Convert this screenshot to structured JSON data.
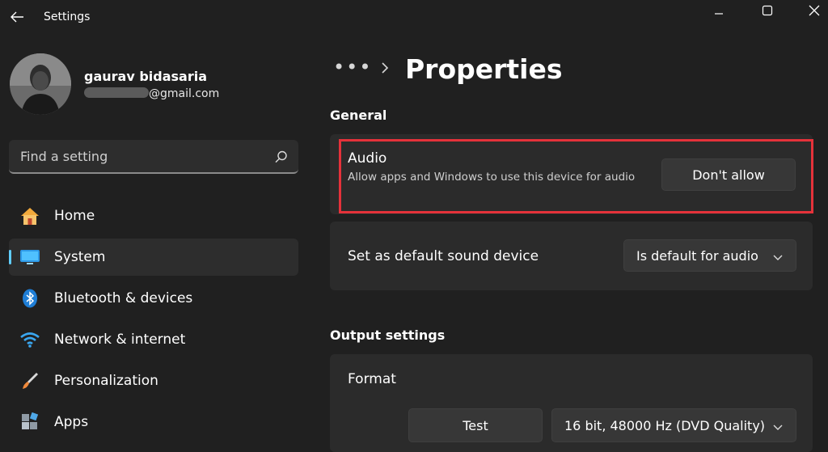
{
  "window": {
    "title": "Settings",
    "back_icon": "back-arrow-icon",
    "controls": [
      "minimize-icon",
      "maximize-icon",
      "close-icon"
    ]
  },
  "user": {
    "name": "gaurav bidasaria",
    "email_suffix": "@gmail.com"
  },
  "search": {
    "placeholder": "Find a setting",
    "icon": "search-icon"
  },
  "sidebar": {
    "items": [
      {
        "label": "Home",
        "icon": "home-icon"
      },
      {
        "label": "System",
        "icon": "system-monitor-icon",
        "active": true
      },
      {
        "label": "Bluetooth & devices",
        "icon": "bluetooth-icon"
      },
      {
        "label": "Network & internet",
        "icon": "wifi-icon"
      },
      {
        "label": "Personalization",
        "icon": "brush-icon"
      },
      {
        "label": "Apps",
        "icon": "apps-icon"
      }
    ]
  },
  "breadcrumb": {
    "overflow": "•••",
    "current": "Properties"
  },
  "general": {
    "heading": "General",
    "audio": {
      "title": "Audio",
      "description": "Allow apps and Windows to use this device for audio",
      "button": "Don't allow"
    },
    "default_device": {
      "title": "Set as default sound device",
      "value": "Is default for audio"
    }
  },
  "output": {
    "heading": "Output settings",
    "format": {
      "title": "Format",
      "test_button": "Test",
      "value": "16 bit, 48000 Hz (DVD Quality)"
    }
  },
  "colors": {
    "background": "#202020",
    "card": "#2b2b2b",
    "accent": "#60cdff",
    "highlight": "#e5323a"
  }
}
